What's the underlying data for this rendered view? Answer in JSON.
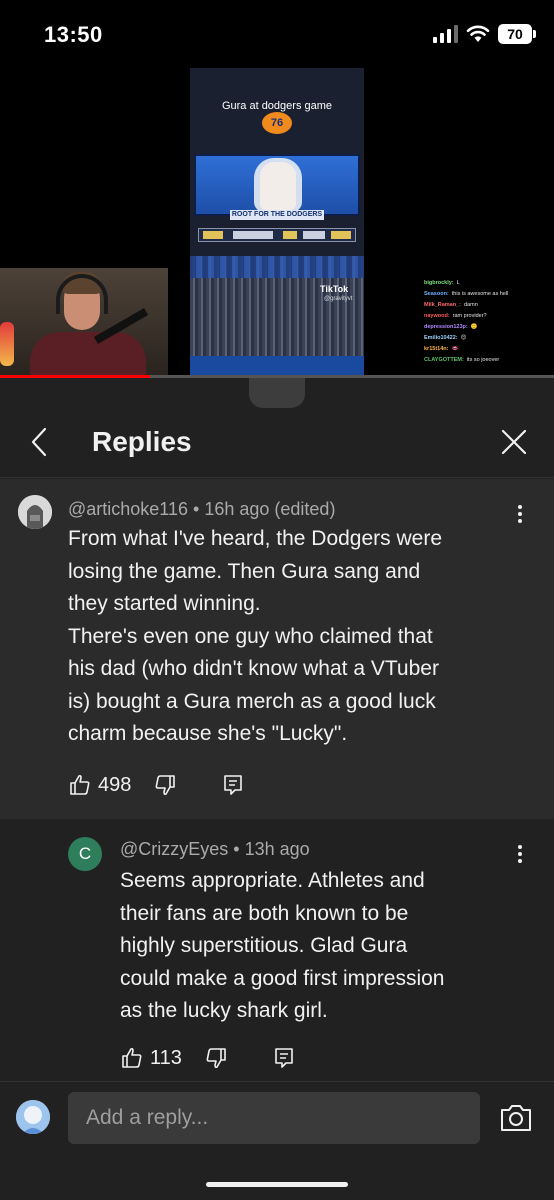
{
  "status_bar": {
    "time": "13:50",
    "battery": "70"
  },
  "video": {
    "tiktok_caption": "Gura at dodgers game",
    "tiktok_badge": "76",
    "tiktok_banner": "ROOT FOR THE DODGERS",
    "tiktok_logo": "TikTok",
    "tiktok_handle": "@gravityvt",
    "progress": 0.27,
    "chat": [
      {
        "user": "bigbrockly:",
        "text": "L",
        "color": "#7fe37f"
      },
      {
        "user": "Seasoon:",
        "text": "this is awesome as hell",
        "color": "#6fb1ff"
      },
      {
        "user": "Milk_Raman_:",
        "text": "damn",
        "color": "#ff6b6b"
      },
      {
        "user": "naywood:",
        "text": "ram provider?",
        "color": "#ff5c5c"
      },
      {
        "user": "depression123p:",
        "text": "🙂",
        "color": "#b08cff"
      },
      {
        "user": "Emilio10422:",
        "text": "😊",
        "color": "#9fd3ff"
      },
      {
        "user": "kr15t14n:",
        "text": "👄",
        "color": "#ffb347"
      },
      {
        "user": "CLAYGOTTEM:",
        "text": "its so joeover",
        "color": "#5ec26a"
      }
    ]
  },
  "sheet": {
    "title": "Replies"
  },
  "parent_comment": {
    "author": "@artichoke116",
    "time": "16h ago (edited)",
    "lines": [
      "From what I've heard, the Dodgers were",
      "losing the game. Then Gura sang and",
      "they started winning.",
      "There's even one guy who claimed that",
      "his dad (who didn't know what a VTuber",
      "is) bought a Gura merch as a good luck",
      "charm because she's \"Lucky\"."
    ],
    "likes": "498"
  },
  "reply_comment": {
    "author": "@CrizzyEyes",
    "avatar_letter": "C",
    "avatar_color": "#2e7d5b",
    "time": "13h ago",
    "lines": [
      "Seems appropriate. Athletes and",
      "their fans are both known to be",
      "highly superstitious. Glad Gura",
      "could make a good first impression",
      "as the lucky shark girl."
    ],
    "likes": "113"
  },
  "reply_bar": {
    "placeholder": "Add a reply..."
  },
  "colors": {
    "accent": "#ff0000",
    "sheet_bg": "#212121",
    "highlight_bg": "#2b2b2b",
    "meta_text": "#aaaaaa"
  }
}
